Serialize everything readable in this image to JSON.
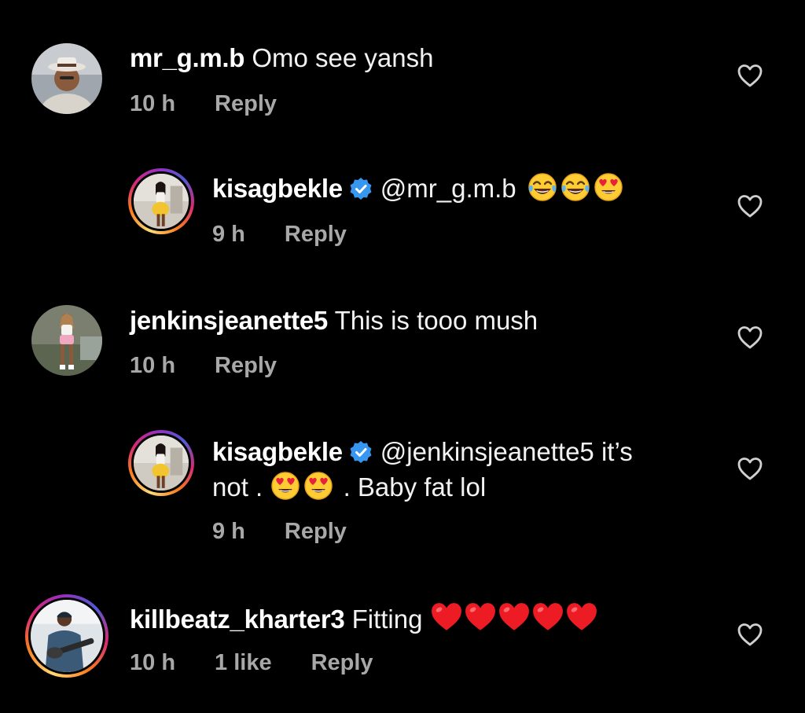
{
  "comments": [
    {
      "username": "mr_g.m.b",
      "text": "Omo see yansh",
      "time": "10 h",
      "reply_label": "Reply"
    },
    {
      "username": "kisagbekle",
      "mention": "@mr_g.m.b",
      "emojis": [
        "face-with-tears-of-joy",
        "face-with-tears-of-joy",
        "smiling-face-with-heart-eyes"
      ],
      "time": "9 h",
      "reply_label": "Reply"
    },
    {
      "username": "jenkinsjeanette5",
      "text": "This is tooo mush",
      "time": "10 h",
      "reply_label": "Reply"
    },
    {
      "username": "kisagbekle",
      "mention": "@jenkinsjeanette5",
      "text_line1_end": "it’s",
      "text_line2_start": "not .",
      "emojis": [
        "smiling-face-with-heart-eyes",
        "smiling-face-with-heart-eyes"
      ],
      "text_line2_end": ". Baby fat lol",
      "time": "9 h",
      "reply_label": "Reply"
    },
    {
      "username": "killbeatz_kharter3",
      "text": "Fitting",
      "emojis": [
        "red-heart",
        "red-heart",
        "red-heart",
        "red-heart",
        "red-heart"
      ],
      "time": "10 h",
      "likes": "1 like",
      "reply_label": "Reply"
    }
  ],
  "colors": {
    "background": "#000000",
    "text": "#f5f5f5",
    "meta": "#a8a8a8",
    "verified": "#3797f0",
    "heart": "#ed1c24"
  }
}
